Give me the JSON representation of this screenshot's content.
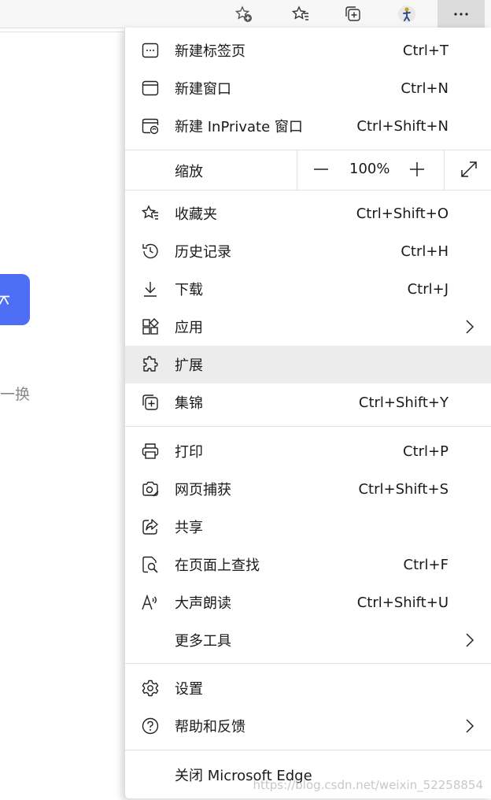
{
  "toolbar": {
    "icons": [
      "add-favorite-icon",
      "favorites-icon",
      "collections-icon",
      "profile-avatar",
      "more-icon"
    ]
  },
  "background": {
    "huan_text": "一换"
  },
  "menu": {
    "items": [
      {
        "label": "新建标签页",
        "shortcut": "Ctrl+T"
      },
      {
        "label": "新建窗口",
        "shortcut": "Ctrl+N"
      },
      {
        "label": "新建 InPrivate 窗口",
        "shortcut": "Ctrl+Shift+N"
      }
    ],
    "zoom": {
      "label": "缩放",
      "value": "100%"
    },
    "items2": [
      {
        "label": "收藏夹",
        "shortcut": "Ctrl+Shift+O"
      },
      {
        "label": "历史记录",
        "shortcut": "Ctrl+H"
      },
      {
        "label": "下载",
        "shortcut": "Ctrl+J"
      },
      {
        "label": "应用",
        "shortcut": ""
      },
      {
        "label": "扩展",
        "shortcut": ""
      },
      {
        "label": "集锦",
        "shortcut": "Ctrl+Shift+Y"
      }
    ],
    "items3": [
      {
        "label": "打印",
        "shortcut": "Ctrl+P"
      },
      {
        "label": "网页捕获",
        "shortcut": "Ctrl+Shift+S"
      },
      {
        "label": "共享",
        "shortcut": ""
      },
      {
        "label": "在页面上查找",
        "shortcut": "Ctrl+F"
      },
      {
        "label": "大声朗读",
        "shortcut": "Ctrl+Shift+U"
      },
      {
        "label": "更多工具",
        "shortcut": ""
      }
    ],
    "items4": [
      {
        "label": "设置",
        "shortcut": ""
      },
      {
        "label": "帮助和反馈",
        "shortcut": ""
      }
    ],
    "close": {
      "label": "关闭 Microsoft Edge"
    }
  },
  "watermark": "https://blog.csdn.net/weixin_52258854"
}
